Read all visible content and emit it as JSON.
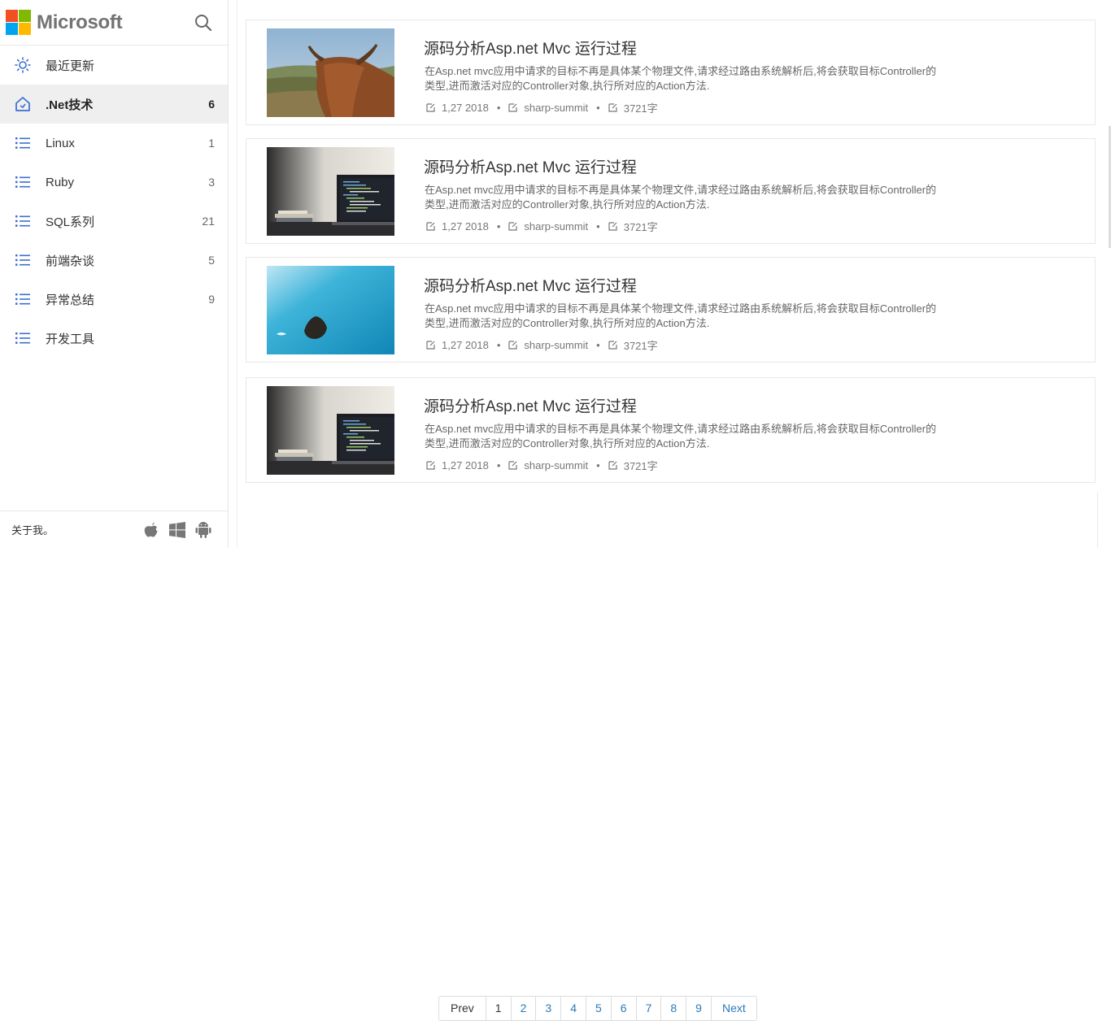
{
  "brand": {
    "name": "Microsoft"
  },
  "nav": [
    {
      "label": "最近更新",
      "count": "",
      "icon": "sun-icon",
      "active": false
    },
    {
      "label": ".Net技术",
      "count": "6",
      "icon": "home-icon",
      "active": true
    },
    {
      "label": "Linux",
      "count": "1",
      "icon": "list-icon",
      "active": false
    },
    {
      "label": "Ruby",
      "count": "3",
      "icon": "list-icon",
      "active": false
    },
    {
      "label": "SQL系列",
      "count": "21",
      "icon": "list-icon",
      "active": false
    },
    {
      "label": "前端杂谈",
      "count": "5",
      "icon": "list-icon",
      "active": false
    },
    {
      "label": "异常总结",
      "count": "9",
      "icon": "list-icon",
      "active": false
    },
    {
      "label": "开发工具",
      "count": "",
      "icon": "list-icon",
      "active": false
    }
  ],
  "footer": {
    "about": "关于我。",
    "icons": [
      "apple-icon",
      "windows-icon",
      "android-icon"
    ]
  },
  "posts": [
    {
      "title": "源码分析Asp.net Mvc 运行过程",
      "desc": "在Asp.net mvc应用中请求的目标不再是具体某个物理文件,请求经过路由系统解析后,将会获取目标Controller的类型,进而激活对应的Controller对象,执行所对应的Action方法.",
      "date": "1,27 2018",
      "tag": "sharp-summit",
      "words": "3721字",
      "image": "highland-cow"
    },
    {
      "title": "源码分析Asp.net Mvc 运行过程",
      "desc": "在Asp.net mvc应用中请求的目标不再是具体某个物理文件,请求经过路由系统解析后,将会获取目标Controller的类型,进而激活对应的Controller对象,执行所对应的Action方法.",
      "date": "1,27 2018",
      "tag": "sharp-summit",
      "words": "3721字",
      "image": "laptop"
    },
    {
      "title": "源码分析Asp.net Mvc 运行过程",
      "desc": "在Asp.net mvc应用中请求的目标不再是具体某个物理文件,请求经过路由系统解析后,将会获取目标Controller的类型,进而激活对应的Controller对象,执行所对应的Action方法.",
      "date": "1,27 2018",
      "tag": "sharp-summit",
      "words": "3721字",
      "image": "ocean-rock"
    },
    {
      "title": "源码分析Asp.net Mvc 运行过程",
      "desc": "在Asp.net mvc应用中请求的目标不再是具体某个物理文件,请求经过路由系统解析后,将会获取目标Controller的类型,进而激活对应的Controller对象,执行所对应的Action方法.",
      "date": "1,27 2018",
      "tag": "sharp-summit",
      "words": "3721字",
      "image": "laptop"
    }
  ],
  "pager": {
    "prev": "Prev",
    "pages": [
      "1",
      "2",
      "3",
      "4",
      "5",
      "6",
      "7",
      "8",
      "9"
    ],
    "current": "1",
    "next": "Next"
  },
  "colors": {
    "accent": "#3b6fd1",
    "link": "#2a7ab8",
    "active_bg": "#efefef"
  }
}
